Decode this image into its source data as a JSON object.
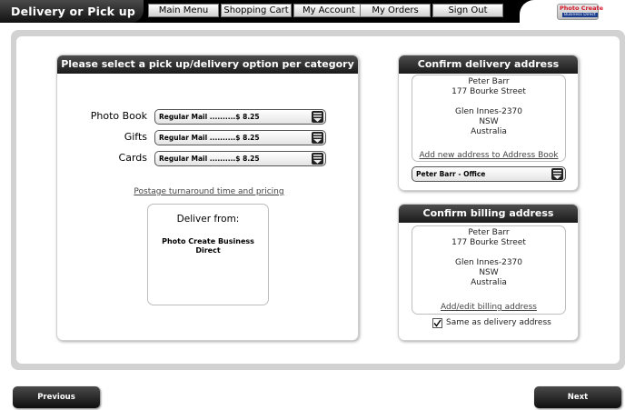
{
  "header": {
    "title": "Delivery or Pick up",
    "nav": [
      "Main Menu",
      "Shopping Cart",
      "My Account",
      "My Orders",
      "Sign Out"
    ],
    "logo_text": "Photo Create",
    "logo_sub": "Business Direct"
  },
  "options_panel": {
    "title": "Please select a pick up/delivery option per category",
    "categories": [
      {
        "label": "Photo Book",
        "value": "Regular Mail ..........$ 8.25"
      },
      {
        "label": "Gifts",
        "value": "Regular Mail ..........$ 8.25"
      },
      {
        "label": "Cards",
        "value": "Regular Mail ..........$ 8.25"
      }
    ],
    "postage_link": "Postage turnaround time and pricing",
    "deliver_from": {
      "heading": "Deliver from:",
      "name": "Photo Create Business Direct"
    }
  },
  "delivery_panel": {
    "title": "Confirm delivery address",
    "address": [
      "Peter Barr",
      "177 Bourke Street",
      "",
      "Glen Innes-2370",
      "NSW",
      "Australia"
    ],
    "add_link": "Add new address to Address Book",
    "address_select": "Peter Barr - Office"
  },
  "billing_panel": {
    "title": "Confirm billing address",
    "address": [
      "Peter Barr",
      "177 Bourke Street",
      "",
      "Glen Innes-2370",
      "NSW",
      "Australia"
    ],
    "edit_link": "Add/edit billing address",
    "same_as_delivery_label": "Same as delivery address",
    "same_as_delivery_checked": true
  },
  "footer": {
    "previous_label": "Previous",
    "next_label": "Next"
  },
  "colors": {
    "dark_bar": "#000000",
    "frame_gray": "#d2d2d2",
    "logo_red": "#d61a2c",
    "logo_blue": "#1a3c8c"
  }
}
